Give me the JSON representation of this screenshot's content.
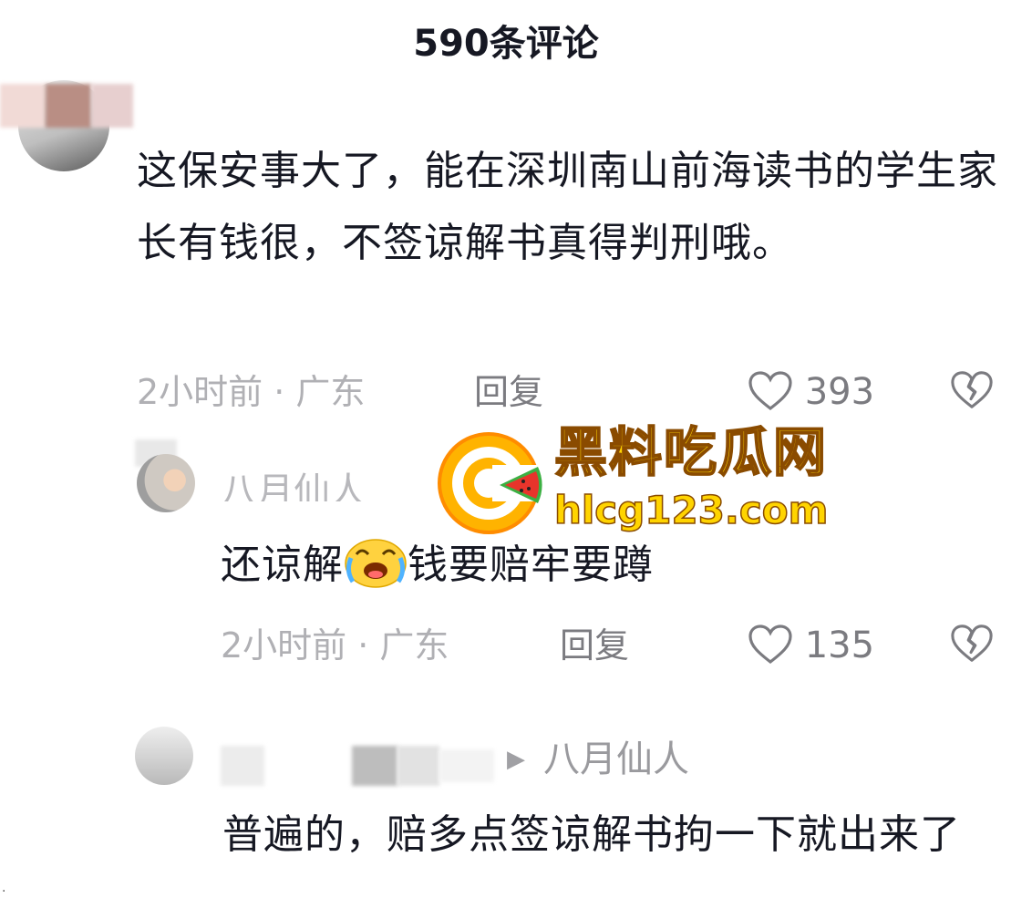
{
  "header": {
    "title": "590条评论"
  },
  "main_comment": {
    "text": "这保安事大了，能在深圳南山前海读书的学生家长有钱很，不签谅解书真得判刑哦。",
    "time_location": "2小时前 · 广东",
    "reply_label": "回复",
    "like_count": "393"
  },
  "reply_1": {
    "author": "八月仙人",
    "text_before_emoji": "还谅解",
    "emoji_name": "laugh-cry-emoji",
    "text_after_emoji": "钱要赔牢要蹲",
    "time_location": "2小时前 · 广东",
    "reply_label": "回复",
    "like_count": "135"
  },
  "reply_2": {
    "reply_to": "八月仙人",
    "text": "普遍的，赔多点签谅解书拘一下就出来了"
  },
  "watermark": {
    "title": "黑料吃瓜网",
    "url": "hlcg123.com"
  },
  "colors": {
    "text_primary": "#161823",
    "text_secondary": "#b0b0b4",
    "watermark_yellow": "#ffd400",
    "watermark_orange": "#ff9900",
    "watermark_red": "#e8342b"
  }
}
